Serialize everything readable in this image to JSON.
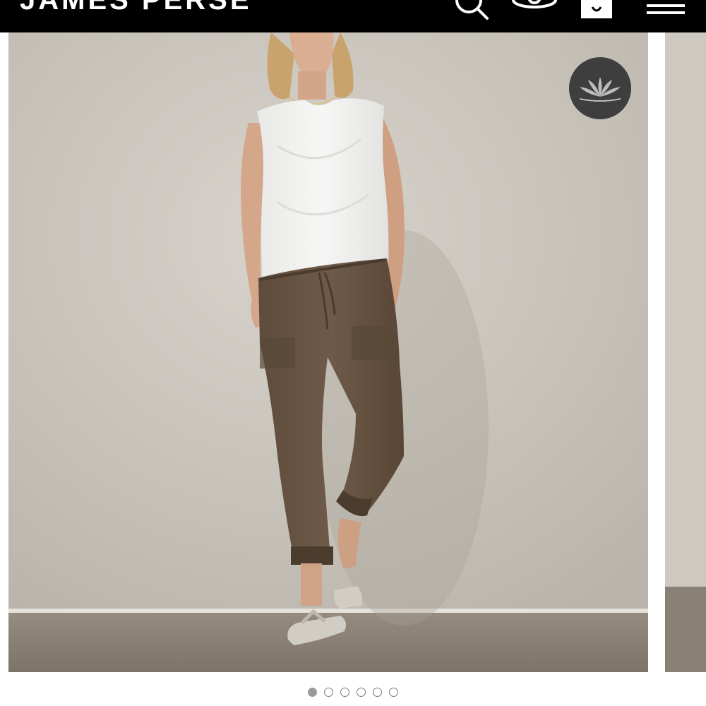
{
  "header": {
    "brand": "JAMES PERSE",
    "icons": [
      "search-icon",
      "account-icon",
      "shopping-bag-icon",
      "menu-icon"
    ]
  },
  "carousel": {
    "badge_icon": "lotus-icon",
    "slide_count": 6,
    "active_index": 0
  },
  "colors": {
    "header_bg": "#000000",
    "wall": "#cdc9c1",
    "floor": "#8a8176",
    "badge_bg": "#3e3e3e"
  }
}
